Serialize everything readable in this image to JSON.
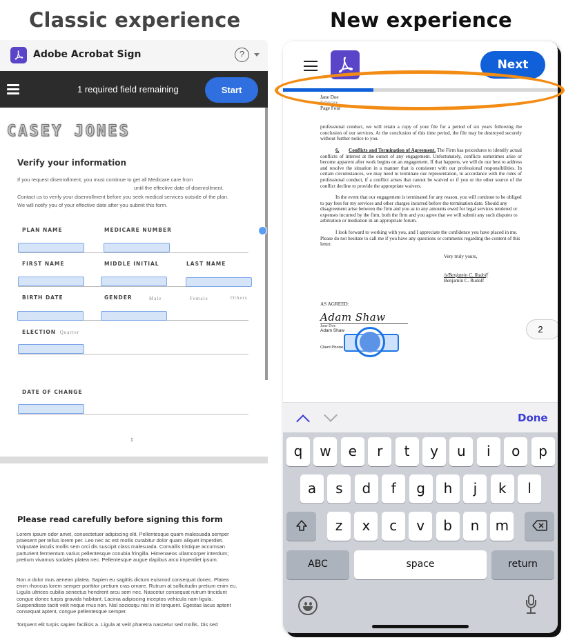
{
  "headings": {
    "classic": "Classic experience",
    "new": "New experience"
  },
  "classic": {
    "app_title": "Adobe Acrobat Sign",
    "help_icon": "?",
    "status_text": "1 required field remaining",
    "start_label": "Start",
    "logo_text": "CASEY JONES",
    "verify": {
      "title": "Verify your information",
      "lines": [
        "If you request disenrollment, you must continue to get all Medicare care from",
        "until the effective date of disenrollment.",
        "Contact us to verify your disenrollment before you seek medical services outside of the plan.",
        "We will notify you of your effective date after you submit this form."
      ]
    },
    "fields": {
      "plan_name": "PLAN NAME",
      "medicare_number": "MEDICARE NUMBER",
      "first_name": "FIRST NAME",
      "middle_initial": "MIDDLE INITIAL",
      "last_name": "LAST NAME",
      "birth_date": "BIRTH DATE",
      "gender": "GENDER",
      "gender_options": [
        "Male",
        "Female",
        "Others"
      ],
      "election": "ELECTION",
      "election_option": "Quarter",
      "date_of_change": "DATE OF CHANGE"
    },
    "page_number": "1",
    "read": {
      "title": "Please read carefully before signing this form",
      "paragraphs": [
        "Lorem ipsum odor amet, consectetuer adipiscing elit. Pellentesque quam malesuada semper praesent per tellus lorem per. Leo nec ac est mollis curabitur dolor quam aliquet imperdiet. Vulputate iaculis mollis sem orci dis suscipit class malesuada. Convallis tristique accumsan parturient fermentum varius pellentesque conubia fringilla. Himenaeos ullamcorper interdum; pretium vivamus sodales platea nec. Pellentesque augue dapibus arcu imperdiet ipsum.",
        "Non a dolor mus aenean platea. Sapien eu sagittis dictum euismod consequat donec. Platea enim rhoncus lorem semper porttitor pretium cras ornare. Rutrum at sollicitudin pretium enim eu. Ligula ultrices cubilia senectus hendrerit arcu sem nec. Nascetur consequat rutrum tincidunt congue donec turpis gravida habitant. Lacinia adipiscing inceptos vehicula nam ligula. Suspendisse taciti velit neque mus non. Nisl sociosqu nisi in id torquent. Egestas lacus aptent consequat aptent, congue pellentesque semper.",
        "Torquent elit turpis sapien facilisis a. Ligula at velit pharetra nascetur sed mollis. Dis sed"
      ]
    }
  },
  "new": {
    "next_label": "Next",
    "progress_fraction": 0.33,
    "letter": {
      "header": [
        "Jane Doe",
        "February",
        "Page Four"
      ],
      "p1": "professional conduct, we will retain a copy of your file for a period of six years following the conclusion of our services. At the conclusion of this time period, the file may be destroyed securely without further notice to you.",
      "section_num": "6.",
      "section_title": "Conflicts and Termination of Agreement.",
      "p2": "The Firm has procedures to identify actual conflicts of interest at the outset of any engagement. Unfortunately, conflicts sometimes arise or become apparent after work begins on an engagement. If that happens, we will do our best to address and resolve the situation in a manner that is consistent with our professional responsibilities. In certain circumstances, we may need to terminate our representation, in accordance with the rules of professional conduct, if a conflict arises that cannot be waived or if you or the other source of the conflict decline to provide the appropriate waivers.",
      "p3": "In the event that our engagement is terminated for any reason, you will continue to be obliged to pay fees for my services and other charges incurred before the termination date. Should any disagreement arise between the firm and you as to any amounts owed for legal services rendered or expenses incurred by the firm, both the firm and you agree that we will submit any such disputes to arbitration or mediation in an appropriate forum.",
      "p4": "I look forward to working with you, and I appreciate the confidence you have placed in me. Please do not hesitate to call me if you have any questions or comments regarding the content of this letter.",
      "closing": "Very truly yours,",
      "esig": "/s/Benjamin C. Rudolf",
      "signer": "Benjamin C. Rudolf",
      "as_agreed": "AS AGREED:",
      "signature": "Adam Shaw",
      "under_sig_1": "Jane Doe",
      "under_sig_2": "Adam Shaw",
      "client_phone": "Client Phone"
    },
    "page_indicator": "2",
    "keyboard": {
      "done_label": "Done",
      "row1": [
        "q",
        "w",
        "e",
        "r",
        "t",
        "y",
        "u",
        "i",
        "o",
        "p"
      ],
      "row2": [
        "a",
        "s",
        "d",
        "f",
        "g",
        "h",
        "j",
        "k",
        "l"
      ],
      "row3": [
        "z",
        "x",
        "c",
        "v",
        "b",
        "n",
        "m"
      ],
      "abc_label": "ABC",
      "space_label": "space",
      "return_label": "return"
    }
  },
  "colors": {
    "accent_blue": "#1060d9",
    "acrobat_purple": "#5a44c8",
    "highlight_orange": "#f28c14"
  }
}
